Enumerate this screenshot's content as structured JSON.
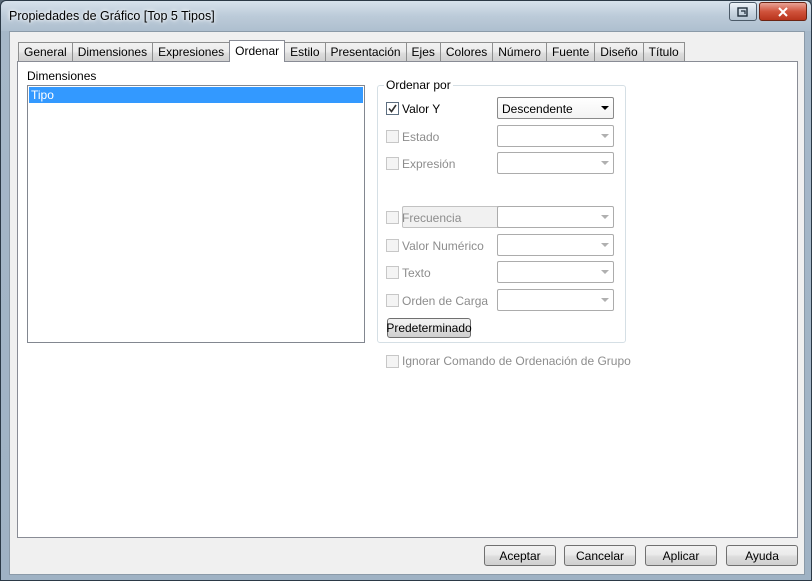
{
  "window": {
    "title": "Propiedades de Gráfico [Top 5 Tipos]"
  },
  "tabs": [
    {
      "label": "General"
    },
    {
      "label": "Dimensiones"
    },
    {
      "label": "Expresiones"
    },
    {
      "label": "Ordenar",
      "active": true
    },
    {
      "label": "Estilo"
    },
    {
      "label": "Presentación"
    },
    {
      "label": "Ejes"
    },
    {
      "label": "Colores"
    },
    {
      "label": "Número"
    },
    {
      "label": "Fuente"
    },
    {
      "label": "Diseño"
    },
    {
      "label": "Título"
    }
  ],
  "dimensions": {
    "label": "Dimensiones",
    "items": [
      "Tipo"
    ]
  },
  "sort": {
    "group_title": "Ordenar por",
    "valor_y": {
      "label": "Valor Y",
      "checked": true,
      "combo": "Descendente"
    },
    "estado": {
      "label": "Estado"
    },
    "expresion": {
      "label": "Expresión"
    },
    "frecuencia": {
      "label": "Frecuencia"
    },
    "valor_numerico": {
      "label": "Valor Numérico"
    },
    "texto": {
      "label": "Texto"
    },
    "orden_carga": {
      "label": "Orden de Carga"
    },
    "default_button": "Predeterminado",
    "ignore_group": "Ignorar Comando de Ordenación de Grupo"
  },
  "buttons": {
    "accept": "Aceptar",
    "cancel": "Cancelar",
    "apply": "Aplicar",
    "help": "Ayuda"
  },
  "colors": {
    "selection": "#3399ff",
    "close_button": "#d0533c"
  }
}
